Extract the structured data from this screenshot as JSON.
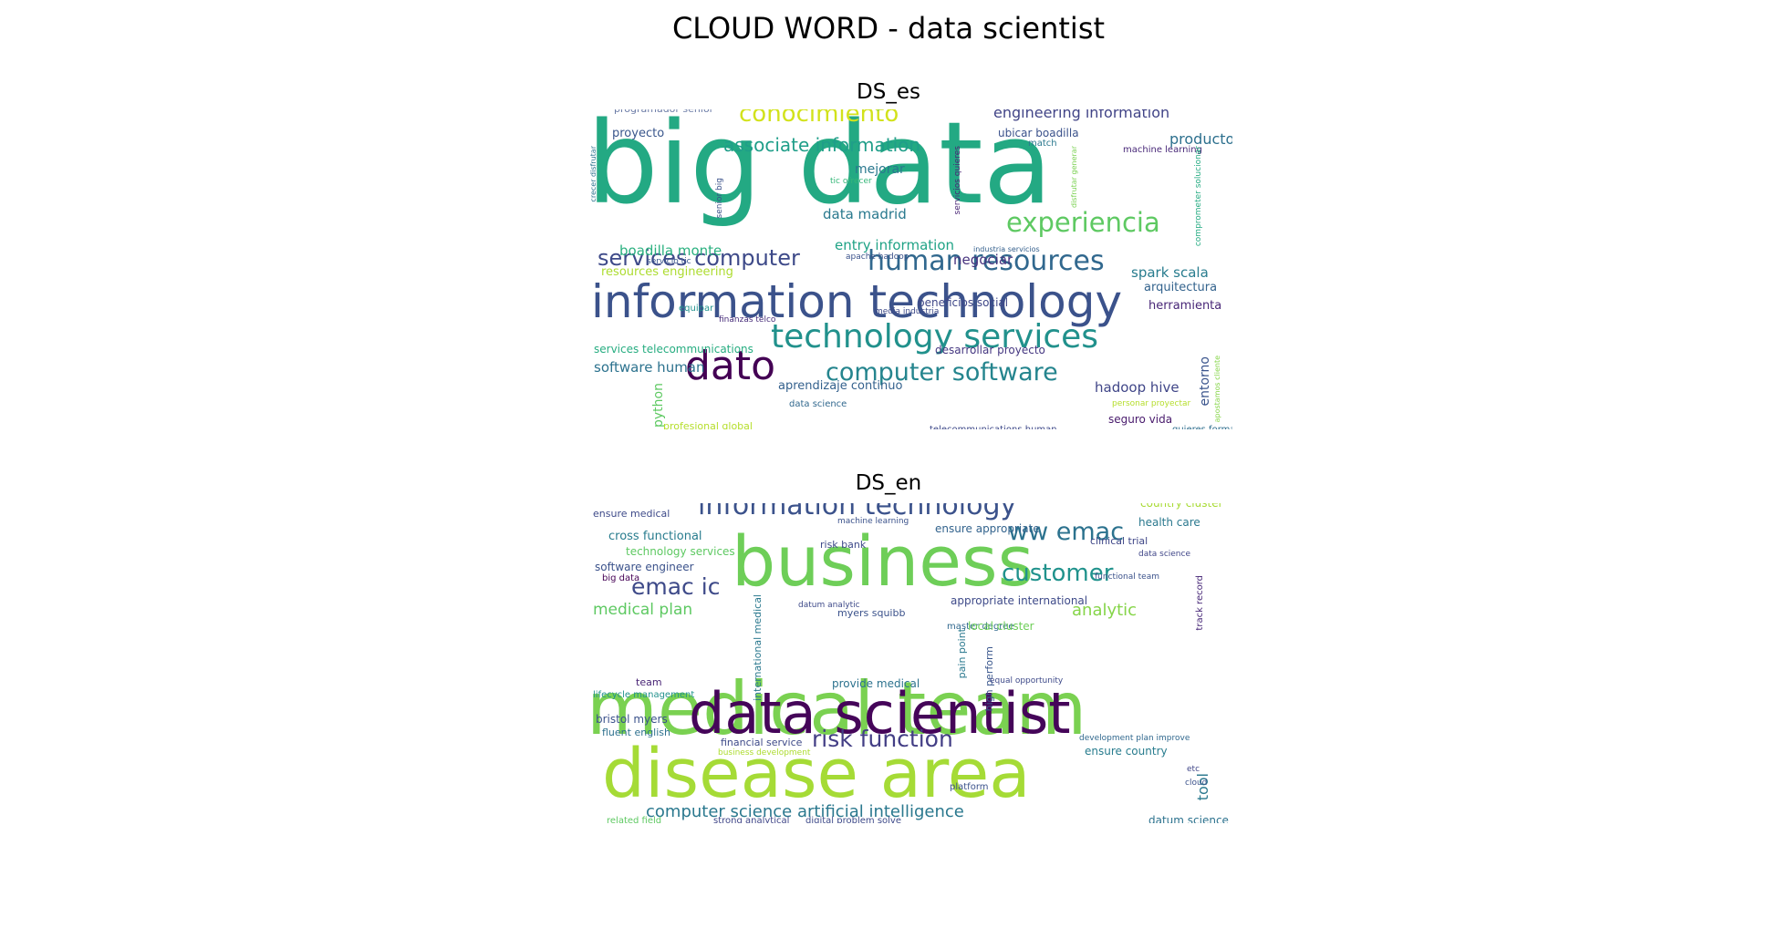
{
  "figure": {
    "title": "CLOUD WORD - data scientist"
  },
  "panels": [
    {
      "title": "DS_es",
      "words": [
        {
          "text": "big data",
          "color": "#23a983"
        },
        {
          "text": "information technology",
          "color": "#3b528b"
        },
        {
          "text": "technology services",
          "color": "#21918c"
        },
        {
          "text": "human resources",
          "color": "#31688e"
        },
        {
          "text": "dato",
          "color": "#440154"
        },
        {
          "text": "computer software",
          "color": "#25858e"
        },
        {
          "text": "experiencia",
          "color": "#5ec962"
        },
        {
          "text": "services computer",
          "color": "#3e4a89"
        },
        {
          "text": "conocimiento",
          "color": "#d2e21b"
        },
        {
          "text": "associate information",
          "color": "#1f9e89"
        },
        {
          "text": "engineering information",
          "color": "#414487"
        },
        {
          "text": "producto",
          "color": "#2d708e"
        },
        {
          "text": "programador senior",
          "color": "#6e7ea8"
        },
        {
          "text": "proyecto",
          "color": "#39568c"
        },
        {
          "text": "mejorar",
          "color": "#2a788e"
        },
        {
          "text": "data madrid",
          "color": "#29798e"
        },
        {
          "text": "entry information",
          "color": "#20a386"
        },
        {
          "text": "boadilla monte",
          "color": "#2ab07f"
        },
        {
          "text": "negociar",
          "color": "#46327e"
        },
        {
          "text": "spark scala",
          "color": "#287c8e"
        },
        {
          "text": "arquitectura",
          "color": "#33638d"
        },
        {
          "text": "herramienta",
          "color": "#482677"
        },
        {
          "text": "resources engineering",
          "color": "#addc30"
        },
        {
          "text": "beneficios social",
          "color": "#3f4788"
        },
        {
          "text": "software human",
          "color": "#2c728e"
        },
        {
          "text": "desarrollar proyecto",
          "color": "#453781"
        },
        {
          "text": "hadoop hive",
          "color": "#404688"
        },
        {
          "text": "aprendizaje continuo",
          "color": "#34618d"
        },
        {
          "text": "python",
          "color": "#5ec962"
        },
        {
          "text": "entorno",
          "color": "#3a548c"
        },
        {
          "text": "seguro vida",
          "color": "#481a6c"
        },
        {
          "text": "ubicar boadilla",
          "color": "#3b528b"
        },
        {
          "text": "machine learning",
          "color": "#482878"
        },
        {
          "text": "match",
          "color": "#2a788e"
        },
        {
          "text": "services telecommunications",
          "color": "#27ad81"
        },
        {
          "text": "profesional global",
          "color": "#b5de2b"
        },
        {
          "text": "data science",
          "color": "#31688e"
        },
        {
          "text": "telecommunications human",
          "color": "#3e4989"
        },
        {
          "text": "quieres formar",
          "color": "#2e6e8e"
        },
        {
          "text": "generar servicio",
          "color": "#6ece58"
        },
        {
          "text": "tic ofrecer",
          "color": "#35b779"
        },
        {
          "text": "apache hadoop",
          "color": "#3b528b"
        },
        {
          "text": "equipar",
          "color": "#21918c"
        },
        {
          "text": "finanzas telco",
          "color": "#472c7a"
        },
        {
          "text": "media industria",
          "color": "#3e4a89"
        },
        {
          "text": "personar proyectar",
          "color": "#b5de2b"
        },
        {
          "text": "senior big",
          "color": "#3b528b"
        },
        {
          "text": "servicio tic",
          "color": "#39568c"
        },
        {
          "text": "servicios quieres",
          "color": "#482475"
        },
        {
          "text": "comprometer solucionar",
          "color": "#25ab82"
        },
        {
          "text": "industria servicios",
          "color": "#35608d"
        },
        {
          "text": "crecer disfrutar",
          "color": "#2c728e"
        },
        {
          "text": "disfrutar generar",
          "color": "#7ad151"
        },
        {
          "text": "apostamos cliente",
          "color": "#86d549"
        }
      ]
    },
    {
      "title": "DS_en",
      "words": [
        {
          "text": "medical team",
          "color": "#7ad151"
        },
        {
          "text": "disease area",
          "color": "#a5db36"
        },
        {
          "text": "data scientist",
          "color": "#450559"
        },
        {
          "text": "business",
          "color": "#6ece58"
        },
        {
          "text": "information technology",
          "color": "#3b528b"
        },
        {
          "text": "ww emac",
          "color": "#2c728e"
        },
        {
          "text": "customer",
          "color": "#20928c"
        },
        {
          "text": "emac ic",
          "color": "#3e4a89"
        },
        {
          "text": "medical plan",
          "color": "#5ec962"
        },
        {
          "text": "analytic",
          "color": "#86d549"
        },
        {
          "text": "risk function",
          "color": "#433e85"
        },
        {
          "text": "computer science artificial intelligence",
          "color": "#2a788e"
        },
        {
          "text": "ensure medical",
          "color": "#3e4a89"
        },
        {
          "text": "cross functional",
          "color": "#287c8e"
        },
        {
          "text": "technology services",
          "color": "#5ec962"
        },
        {
          "text": "software engineer",
          "color": "#3b528b"
        },
        {
          "text": "big data",
          "color": "#440154"
        },
        {
          "text": "country cluster",
          "color": "#a8db34"
        },
        {
          "text": "health care",
          "color": "#2a788e"
        },
        {
          "text": "ensure appropriate",
          "color": "#33638d"
        },
        {
          "text": "clinical trial",
          "color": "#3f4788"
        },
        {
          "text": "risk bank",
          "color": "#3e4a89"
        },
        {
          "text": "data science",
          "color": "#404688"
        },
        {
          "text": "functional team",
          "color": "#3b528b"
        },
        {
          "text": "track record",
          "color": "#482878"
        },
        {
          "text": "appropriate international",
          "color": "#3e4a89"
        },
        {
          "text": "myers squibb",
          "color": "#3b528b"
        },
        {
          "text": "master degree",
          "color": "#31688e"
        },
        {
          "text": "local cluster",
          "color": "#6ece58"
        },
        {
          "text": "international medical",
          "color": "#2a788e"
        },
        {
          "text": "pain point",
          "color": "#2a788e"
        },
        {
          "text": "high perform",
          "color": "#39568c"
        },
        {
          "text": "equal opportunity",
          "color": "#3e4a89"
        },
        {
          "text": "provide medical",
          "color": "#2c728e"
        },
        {
          "text": "team",
          "color": "#482475"
        },
        {
          "text": "lifecycle management",
          "color": "#21918c"
        },
        {
          "text": "bristol myers",
          "color": "#3b528b"
        },
        {
          "text": "fluent english",
          "color": "#2d708e"
        },
        {
          "text": "financial service",
          "color": "#3e4a89"
        },
        {
          "text": "business development",
          "color": "#addc30"
        },
        {
          "text": "development plan improve",
          "color": "#31688e"
        },
        {
          "text": "ensure country",
          "color": "#287c8e"
        },
        {
          "text": "platform",
          "color": "#3b528b"
        },
        {
          "text": "tool",
          "color": "#2a788e"
        },
        {
          "text": "etc",
          "color": "#404688"
        },
        {
          "text": "cloud",
          "color": "#3b528b"
        },
        {
          "text": "datum science",
          "color": "#2c728e"
        },
        {
          "text": "strong analytical",
          "color": "#404688"
        },
        {
          "text": "digital problem solve",
          "color": "#3e4a89"
        },
        {
          "text": "related field",
          "color": "#5ec962"
        },
        {
          "text": "machine learning",
          "color": "#3b528b"
        },
        {
          "text": "datum analytic",
          "color": "#3e4a89"
        }
      ]
    }
  ]
}
